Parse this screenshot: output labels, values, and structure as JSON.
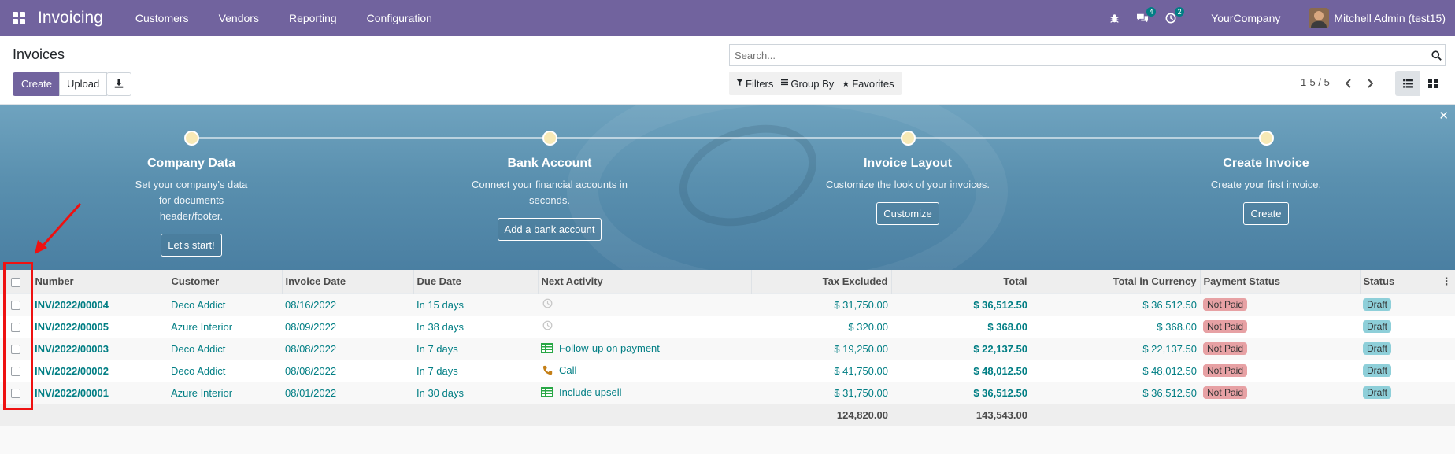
{
  "navbar": {
    "app_name": "Invoicing",
    "menu": [
      "Customers",
      "Vendors",
      "Reporting",
      "Configuration"
    ],
    "messages_count": "4",
    "activities_count": "2",
    "company": "YourCompany",
    "user": "Mitchell Admin (test15)",
    "color": "#71639e"
  },
  "control": {
    "title": "Invoices",
    "create_label": "Create",
    "upload_label": "Upload",
    "search_placeholder": "Search...",
    "filters_label": "Filters",
    "groupby_label": "Group By",
    "favorites_label": "Favorites",
    "pager": "1-5 / 5"
  },
  "banner": {
    "steps": [
      {
        "title": "Company Data",
        "desc": "Set your company's data for documents header/footer.",
        "button": "Let's start!"
      },
      {
        "title": "Bank Account",
        "desc": "Connect your financial accounts in seconds.",
        "button": "Add a bank account"
      },
      {
        "title": "Invoice Layout",
        "desc": "Customize the look of your invoices.",
        "button": "Customize"
      },
      {
        "title": "Create Invoice",
        "desc": "Create your first invoice.",
        "button": "Create"
      }
    ]
  },
  "table": {
    "headers": {
      "number": "Number",
      "customer": "Customer",
      "invoice_date": "Invoice Date",
      "due_date": "Due Date",
      "next_activity": "Next Activity",
      "tax_excluded": "Tax Excluded",
      "total": "Total",
      "total_currency": "Total in Currency",
      "payment_status": "Payment Status",
      "status": "Status"
    },
    "rows": [
      {
        "number": "INV/2022/00004",
        "customer": "Deco Addict",
        "invoice_date": "08/16/2022",
        "due_date": "In 15 days",
        "activity": "",
        "activity_icon": "clock-icon",
        "tax_excluded": "$ 31,750.00",
        "total": "$ 36,512.50",
        "total_currency": "$ 36,512.50",
        "payment_status": "Not Paid",
        "status": "Draft"
      },
      {
        "number": "INV/2022/00005",
        "customer": "Azure Interior",
        "invoice_date": "08/09/2022",
        "due_date": "In 38 days",
        "activity": "",
        "activity_icon": "clock-icon",
        "tax_excluded": "$ 320.00",
        "total": "$ 368.00",
        "total_currency": "$ 368.00",
        "payment_status": "Not Paid",
        "status": "Draft"
      },
      {
        "number": "INV/2022/00003",
        "customer": "Deco Addict",
        "invoice_date": "08/08/2022",
        "due_date": "In 7 days",
        "activity": "Follow-up on payment",
        "activity_icon": "todo-list-icon",
        "tax_excluded": "$ 19,250.00",
        "total": "$ 22,137.50",
        "total_currency": "$ 22,137.50",
        "payment_status": "Not Paid",
        "status": "Draft"
      },
      {
        "number": "INV/2022/00002",
        "customer": "Deco Addict",
        "invoice_date": "08/08/2022",
        "due_date": "In 7 days",
        "activity": "Call",
        "activity_icon": "phone-icon",
        "tax_excluded": "$ 41,750.00",
        "total": "$ 48,012.50",
        "total_currency": "$ 48,012.50",
        "payment_status": "Not Paid",
        "status": "Draft"
      },
      {
        "number": "INV/2022/00001",
        "customer": "Azure Interior",
        "invoice_date": "08/01/2022",
        "due_date": "In 30 days",
        "activity": "Include upsell",
        "activity_icon": "todo-list-icon",
        "tax_excluded": "$ 31,750.00",
        "total": "$ 36,512.50",
        "total_currency": "$ 36,512.50",
        "payment_status": "Not Paid",
        "status": "Draft"
      }
    ],
    "totals": {
      "tax_excluded": "124,820.00",
      "total": "143,543.00"
    }
  }
}
